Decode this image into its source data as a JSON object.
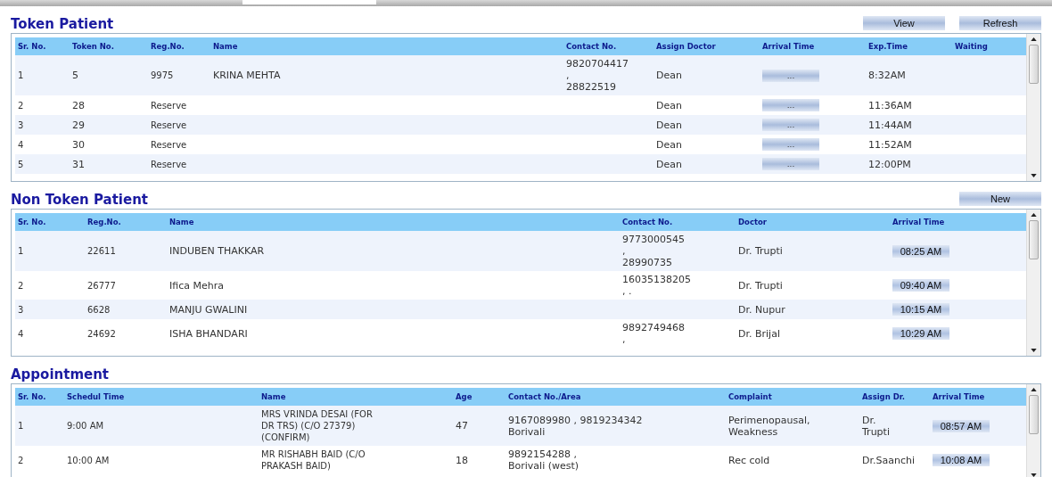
{
  "token_patient": {
    "title": "Token Patient",
    "buttons": [
      "View",
      "Refresh"
    ],
    "columns": [
      {
        "label": "Sr. No.",
        "kind": "small"
      },
      {
        "label": "Token No.",
        "kind": "text"
      },
      {
        "label": "Reg.No.",
        "kind": "small"
      },
      {
        "label": "Name",
        "kind": "text"
      },
      {
        "label": "Contact No.",
        "kind": "text"
      },
      {
        "label": "Assign Doctor",
        "kind": "text"
      },
      {
        "label": "Arrival Time",
        "kind": "button"
      },
      {
        "label": "Exp.Time",
        "kind": "text"
      },
      {
        "label": "Waiting"
      }
    ],
    "rows": [
      [
        "1",
        "5",
        "9975",
        "KRINA MEHTA",
        [
          "9820704417",
          ",",
          "28822519"
        ],
        "Dean",
        "...",
        "8:32AM",
        ""
      ],
      [
        "2",
        "28",
        "Reserve",
        "",
        "",
        "Dean",
        "...",
        "11:36AM",
        ""
      ],
      [
        "3",
        "29",
        "Reserve",
        "",
        "",
        "Dean",
        "...",
        "11:44AM",
        ""
      ],
      [
        "4",
        "30",
        "Reserve",
        "",
        "",
        "Dean",
        "...",
        "11:52AM",
        ""
      ],
      [
        "5",
        "31",
        "Reserve",
        "",
        "",
        "Dean",
        "...",
        "12:00PM",
        ""
      ]
    ]
  },
  "non_token_patient": {
    "title": "Non Token Patient",
    "buttons": [
      "New"
    ],
    "columns": [
      {
        "label": "Sr. No.",
        "kind": "small"
      },
      {
        "label": "Reg.No.",
        "kind": "small"
      },
      {
        "label": "Name",
        "kind": "text"
      },
      {
        "label": "Contact No.",
        "kind": "text"
      },
      {
        "label": "Doctor",
        "kind": "text"
      },
      {
        "label": "Arrival Time",
        "kind": "time"
      }
    ],
    "rows": [
      [
        "1",
        "22611",
        "INDUBEN THAKKAR",
        [
          "9773000545",
          ",",
          "28990735"
        ],
        "Dr. Trupti",
        "08:25 AM"
      ],
      [
        "2",
        "26777",
        "Ifica Mehra",
        [
          "16035138205",
          ", ."
        ],
        "Dr. Trupti",
        "09:40 AM"
      ],
      [
        "3",
        "6628",
        "MANJU GWALINI",
        "",
        "Dr. Nupur",
        "10:15 AM"
      ],
      [
        "4",
        "24692",
        "ISHA BHANDARI",
        [
          "9892749468",
          ","
        ],
        "Dr. Brijal",
        "10:29 AM"
      ]
    ]
  },
  "appointment": {
    "title": "Appointment",
    "columns": [
      {
        "label": "Sr. No.",
        "kind": "small"
      },
      {
        "label": "Schedul Time",
        "kind": "small"
      },
      {
        "label": "Name",
        "kind": "small"
      },
      {
        "label": "Age",
        "kind": "text"
      },
      {
        "label": "Contact No./Area",
        "kind": "text"
      },
      {
        "label": "Complaint",
        "kind": "text"
      },
      {
        "label": "Assign Dr.",
        "kind": "text"
      },
      {
        "label": "Arrival Time",
        "kind": "time"
      }
    ],
    "rows": [
      [
        "1",
        "9:00 AM",
        [
          "MRS VRINDA DESAI (FOR",
          "DR TRS) (C/O 27379)",
          "(CONFIRM)"
        ],
        "47",
        [
          "9167089980 , 9819234342",
          "Borivali"
        ],
        [
          "Perimenopausal,",
          "Weakness"
        ],
        [
          "Dr.",
          "Trupti"
        ],
        "08:57 AM"
      ],
      [
        "2",
        "10:00 AM",
        [
          "MR RISHABH BAID (C/O",
          "PRAKASH BAID)"
        ],
        "18",
        [
          "9892154288 ,",
          "Borivali (west)"
        ],
        "Rec cold",
        "Dr.Saanchi",
        "10:08 AM"
      ]
    ]
  }
}
